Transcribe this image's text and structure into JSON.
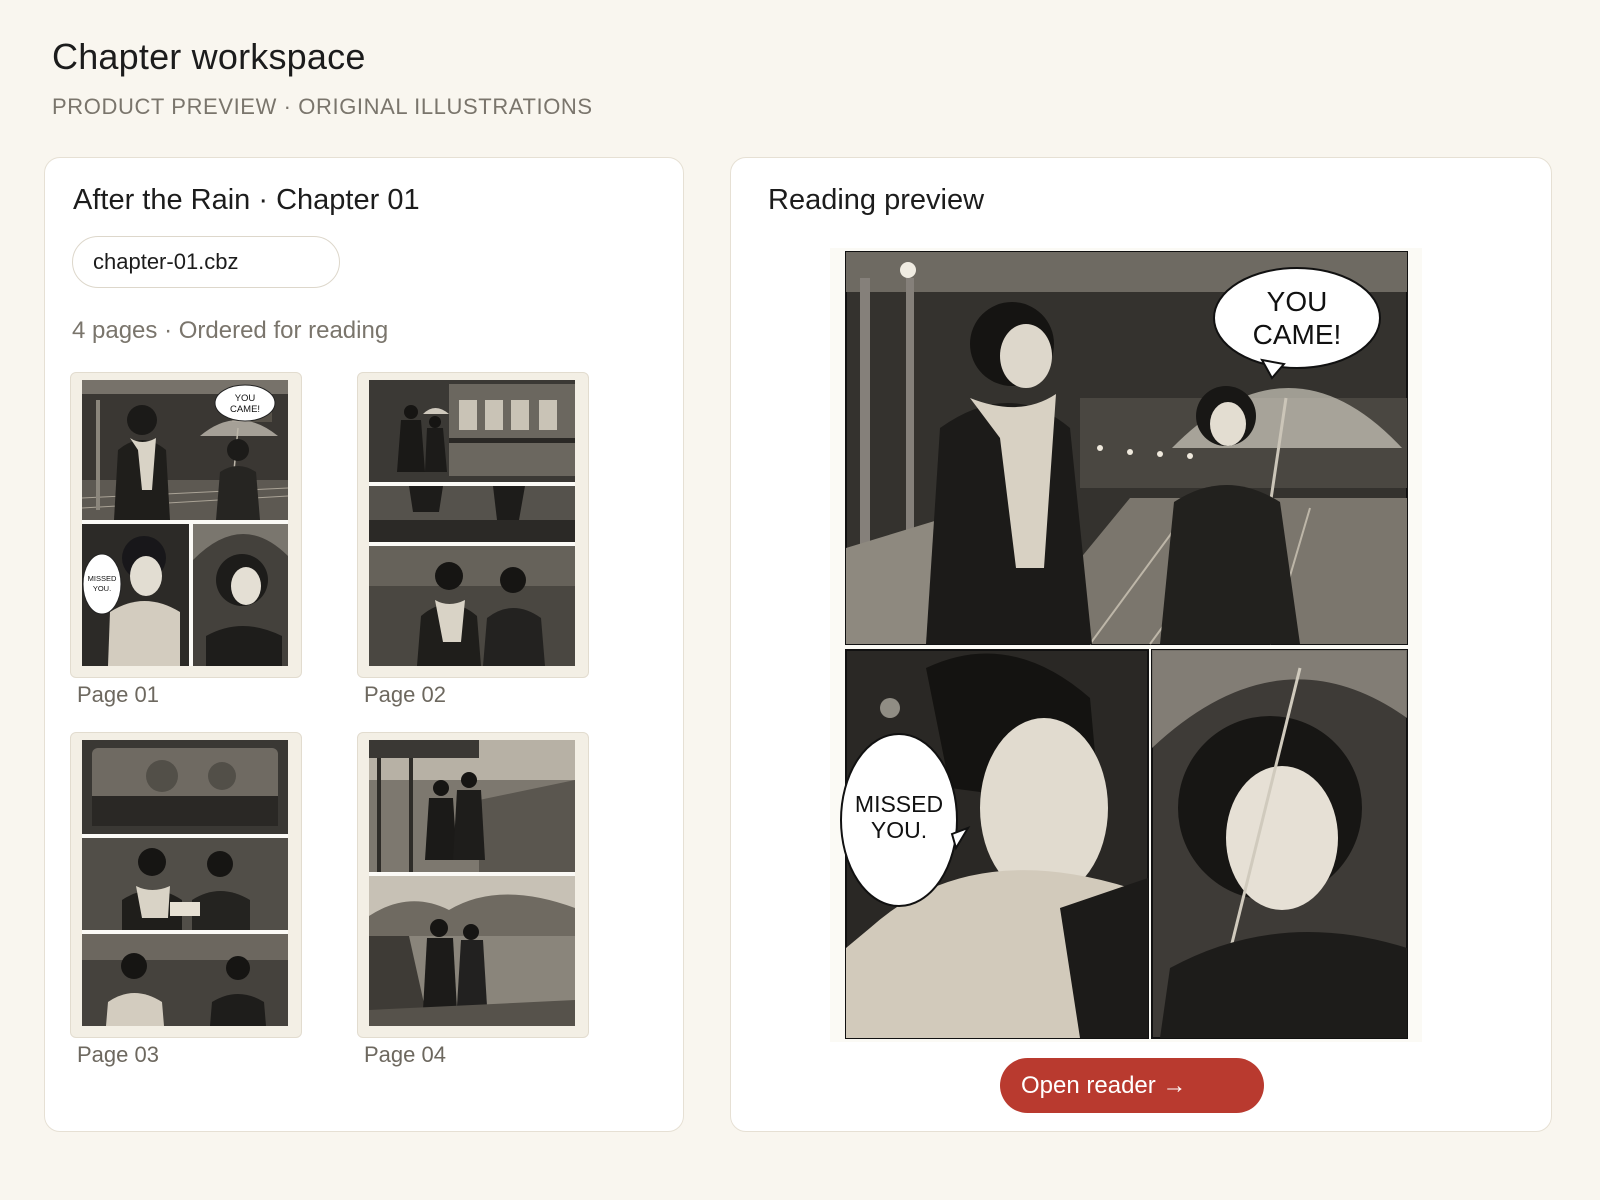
{
  "page": {
    "title": "Chapter workspace",
    "subtitle": "PRODUCT PREVIEW · ORIGINAL ILLUSTRATIONS"
  },
  "chapter": {
    "title": "After the Rain · Chapter 01",
    "file_name": "chapter-01.cbz",
    "page_count_label": "4 pages · Ordered for reading"
  },
  "pages": [
    {
      "label": "Page 01",
      "bubbles": [
        "YOU",
        "CAME!",
        "MISSED",
        "YOU."
      ]
    },
    {
      "label": "Page 02"
    },
    {
      "label": "Page 03"
    },
    {
      "label": "Page 04"
    }
  ],
  "preview": {
    "title": "Reading preview",
    "bubble_top_line1": "YOU",
    "bubble_top_line2": "CAME!",
    "bubble_bottom_line1": "MISSED",
    "bubble_bottom_line2": "YOU.",
    "open_button_label": "Open reader →"
  },
  "colors": {
    "background": "#f9f6ef",
    "card": "#ffffff",
    "accent": "#b93a2f",
    "muted_text": "#7a756c"
  }
}
